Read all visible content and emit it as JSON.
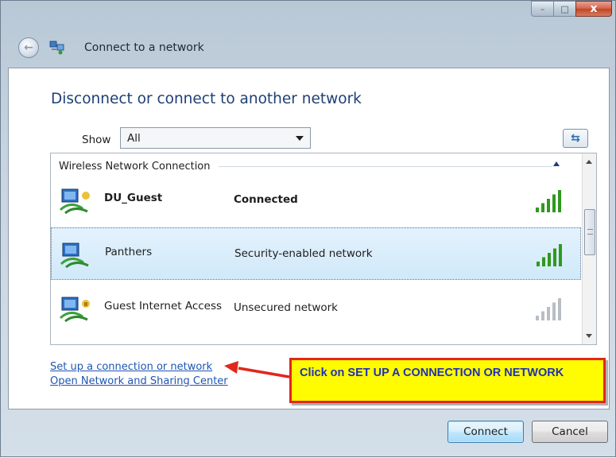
{
  "window": {
    "title": "Connect to a network",
    "caption": {
      "minimize": "–",
      "maximize": "□",
      "close": "x"
    }
  },
  "dialog": {
    "heading": "Disconnect or connect to another network",
    "show_label": "Show",
    "show_selected": "All"
  },
  "network_list": {
    "group": "Wireless Network Connection",
    "items": [
      {
        "name": "DU_Guest",
        "status": "Connected",
        "signal_bars": 5,
        "signal_color": "#2e9a1e",
        "selected": false,
        "bold": true
      },
      {
        "name": "Panthers",
        "status": "Security-enabled network",
        "signal_bars": 5,
        "signal_color": "#2e9a1e",
        "selected": true,
        "bold": false
      },
      {
        "name": "Guest Internet Access",
        "status": "Unsecured network",
        "signal_bars": 5,
        "signal_color": "#b9bec4",
        "selected": false,
        "bold": false
      }
    ]
  },
  "links": {
    "setup": "Set up a connection or network",
    "sharing": "Open Network and Sharing Center"
  },
  "annotation": {
    "text": "Click on SET UP A CONNECTION OR NETWORK"
  },
  "buttons": {
    "connect": "Connect",
    "cancel": "Cancel"
  },
  "colors": {
    "link": "#1f56b3",
    "heading": "#1e3f74",
    "annotation_bg": "#fffb00",
    "annotation_border": "#e0271b",
    "annotation_text": "#1e30b8"
  }
}
